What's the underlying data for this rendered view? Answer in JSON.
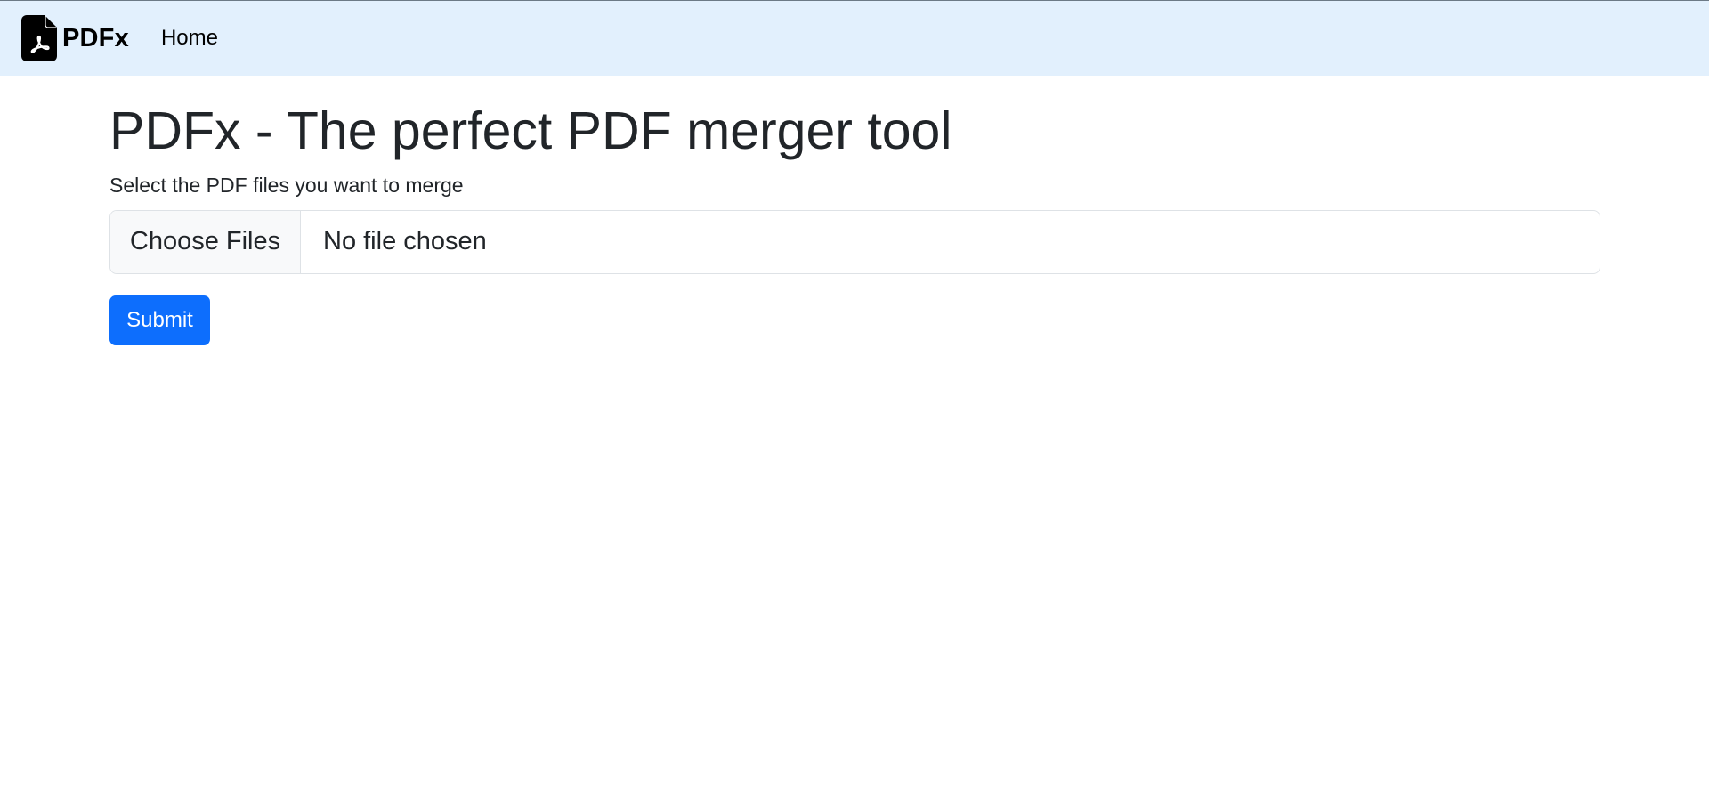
{
  "navbar": {
    "brand": {
      "icon": "pdf-file-icon",
      "name": "PDFx"
    },
    "links": [
      {
        "label": "Home"
      }
    ]
  },
  "main": {
    "title": "PDFx - The perfect PDF merger tool",
    "form": {
      "label": "Select the PDF files you want to merge",
      "file_input": {
        "button_label": "Choose Files",
        "status": "No file chosen"
      },
      "submit_label": "Submit"
    }
  },
  "colors": {
    "navbar_bg": "#e2f0fd",
    "primary": "#0d6efd",
    "text": "#212529"
  }
}
